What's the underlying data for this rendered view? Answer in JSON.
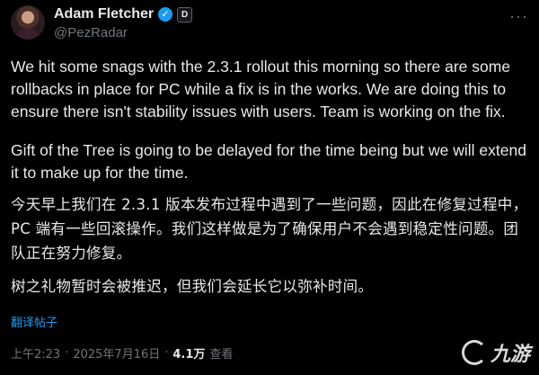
{
  "author": {
    "display_name": "Adam Fletcher",
    "handle": "@PezRadar",
    "affiliate_badge": "D",
    "verified_icon": "check"
  },
  "menu": {
    "more_label": "···"
  },
  "tweet": {
    "english_paragraphs": [
      "We hit some snags with the 2.3.1 rollout this morning so there are some rollbacks in place for PC while a fix is in the works. We are doing this to ensure there isn't stability issues with users. Team is working on the fix.",
      "Gift of the Tree is going to be delayed for the time being but we will extend it to make up for the time."
    ],
    "chinese_paragraphs": [
      "今天早上我们在 2.3.1 版本发布过程中遇到了一些问题，因此在修复过程中，PC 端有一些回滚操作。我们这样做是为了确保用户不会遇到稳定性问题。团队正在努力修复。",
      "树之礼物暂时会被推迟，但我们会延长它以弥补时间。"
    ],
    "translate_label": "翻译帖子"
  },
  "meta": {
    "time": "上午2:23",
    "separator": "·",
    "date": "2025年7月16日",
    "views": "4.1万",
    "views_label": "查看"
  },
  "watermark": {
    "text": "九游"
  },
  "colors": {
    "background": "#000000",
    "text": "#e7e9ea",
    "muted": "#71767b",
    "accent": "#1d9bf0"
  }
}
